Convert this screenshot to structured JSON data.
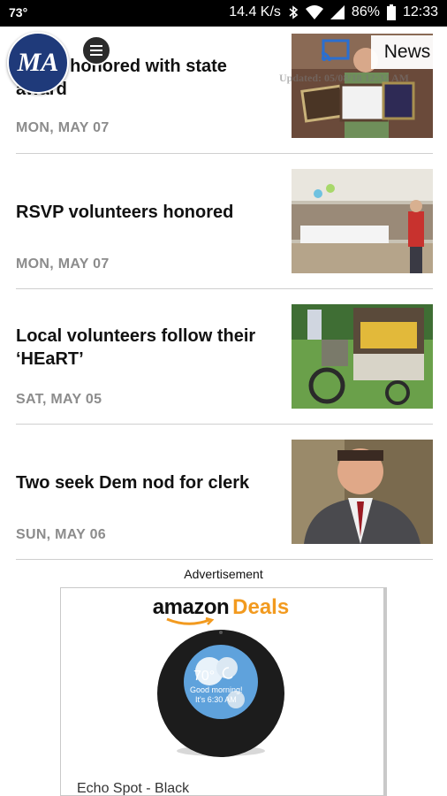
{
  "status_bar": {
    "temperature": "73°",
    "network_speed": "14.4 K/s",
    "battery": "86%",
    "time": "12:33"
  },
  "header": {
    "logo_text": "MA",
    "section_label": "News",
    "updated_text": "Updated: 05/08/18 12:32 AM"
  },
  "stories": [
    {
      "title": "Dixon honored with state award",
      "date": "MON, MAY 07",
      "image": "award-photo"
    },
    {
      "title": "RSVP volunteers honored",
      "date": "MON, MAY 07",
      "image": "banquet-hall-photo"
    },
    {
      "title": "Local volunteers follow their ‘HEaRT’",
      "date": "SAT, MAY 05",
      "image": "rickshaw-photo"
    },
    {
      "title": "Two seek Dem nod for clerk",
      "date": "SUN, MAY 06",
      "image": "portrait-photo"
    }
  ],
  "ad": {
    "label": "Advertisement",
    "brand": "amazon",
    "brand_suffix": "Deals",
    "device_temp": "70°",
    "device_greeting": "Good morning!",
    "device_time": "It's 6:30 AM",
    "product_name": "Echo Spot - Black"
  },
  "colors": {
    "logo_bg": "#1f3a7a",
    "deals_orange": "#f29a1f",
    "date_gray": "#8c8c8c"
  }
}
